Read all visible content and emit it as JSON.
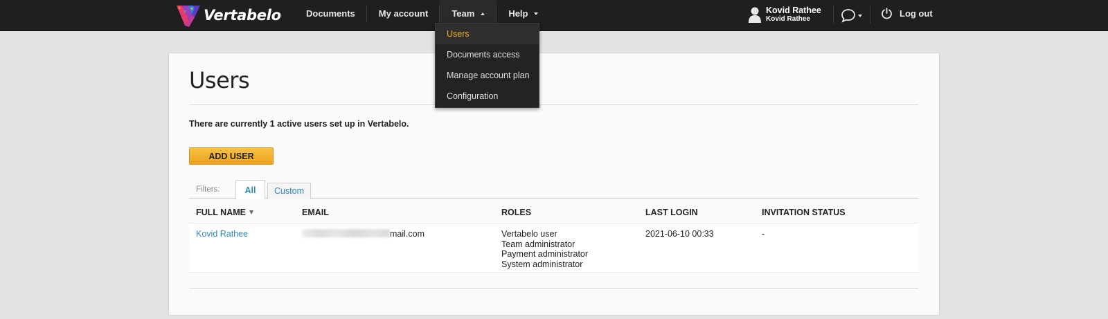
{
  "topbar": {
    "logo_text": "Vertabelo",
    "nav": [
      {
        "label": "Documents",
        "has_caret": false
      },
      {
        "label": "My account",
        "has_caret": false
      },
      {
        "label": "Team",
        "has_caret": true,
        "open": true
      },
      {
        "label": "Help",
        "has_caret": true
      }
    ],
    "user": {
      "name": "Kovid Rathee",
      "subname": "Kovid Rathee"
    },
    "logout_label": "Log out"
  },
  "team_menu": {
    "items": [
      {
        "label": "Users",
        "current": true
      },
      {
        "label": "Documents access"
      },
      {
        "label": "Manage account plan"
      },
      {
        "label": "Configuration"
      }
    ]
  },
  "page": {
    "title": "Users",
    "summary": "There are currently 1 active users set up in Vertabelo.",
    "add_user_label": "ADD USER"
  },
  "filters": {
    "label": "Filters:",
    "tabs": [
      {
        "label": "All",
        "active": true
      },
      {
        "label": "Custom",
        "active": false
      }
    ]
  },
  "table": {
    "columns": [
      "FULL NAME",
      "EMAIL",
      "ROLES",
      "LAST LOGIN",
      "INVITATION STATUS"
    ],
    "sorted_column": "FULL NAME",
    "rows": [
      {
        "full_name": "Kovid Rathee",
        "email_visible": "mail.com",
        "roles": [
          "Vertabelo user",
          "Team administrator",
          "Payment administrator",
          "System administrator"
        ],
        "last_login": "2021-06-10 00:33",
        "invitation_status": "-"
      }
    ]
  },
  "colors": {
    "topbar": "#1f1f1f",
    "accent_orange": "#f4b120",
    "link_blue": "#2e8bb8",
    "button_gradient_top": "#f7c145",
    "button_gradient_bottom": "#eda21d"
  }
}
